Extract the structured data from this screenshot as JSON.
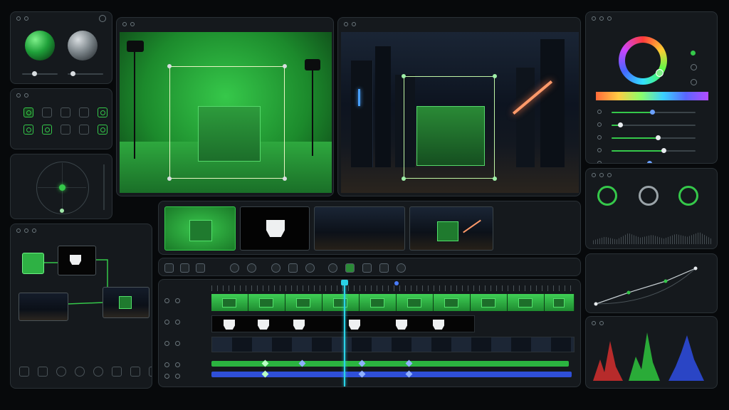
{
  "app": {
    "title": ""
  },
  "colors": {
    "accent": "#35c84a",
    "playhead": "#2ad2e6",
    "blue_track": "#2f4fd8",
    "panel": "#15191d"
  },
  "left_panels": {
    "material_previews": [
      "green-sphere",
      "gray-sphere"
    ],
    "tool_icons": [
      "circle-tool-icon",
      "timer-icon",
      "clock-icon",
      "frame-icon",
      "record-icon",
      "ring-icon",
      "circle-tool-icon",
      "expand-icon",
      "crop-icon",
      "grid-icon"
    ],
    "nav_widget": "joystick"
  },
  "node_graph": {
    "nodes": [
      "green-key-node",
      "matte-node",
      "plate-node",
      "composite-node"
    ],
    "bottom_tools": [
      "cube-icon",
      "cube-icon",
      "sphere-icon",
      "sphere-icon",
      "sphere-icon",
      "grid-icon",
      "cube-icon",
      "cube-icon"
    ]
  },
  "viewers": {
    "left": {
      "scene": "green-screen-studio"
    },
    "right": {
      "scene": "night-city-composite"
    }
  },
  "thumbnails": [
    "green-screen-clip",
    "alpha-matte",
    "city-plate",
    "composite-result"
  ],
  "toolbar": {
    "buttons": [
      "cube-icon",
      "cube-icon",
      "cube-icon",
      "sphere-icon",
      "bulb-icon",
      "sphere-icon",
      "pin-icon",
      "rotate-icon",
      "sphere-icon",
      "grid-icon",
      "grid-icon",
      "paint-icon",
      "record-icon"
    ]
  },
  "timeline": {
    "tracks": [
      "green-screen",
      "matte",
      "background",
      "keyer-params",
      "color-params"
    ],
    "playhead_position": 0.33
  },
  "right_panels": {
    "color_wheel": "hue-wheel",
    "sliders": [
      0.48,
      0.1,
      0.55,
      0.62,
      0.45
    ],
    "knobs": [
      "knob-1",
      "knob-2",
      "knob-3"
    ],
    "curve": "tone-curve",
    "scopes": "rgb-histogram"
  }
}
